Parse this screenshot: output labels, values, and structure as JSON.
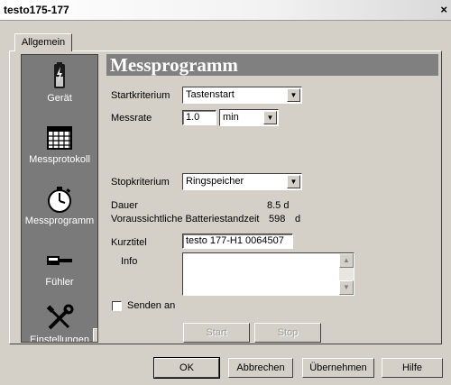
{
  "window": {
    "title": "testo175-177",
    "close_glyph": "×"
  },
  "tabs": [
    {
      "label": "Allgemein",
      "active": true
    }
  ],
  "sidebar": {
    "items": [
      {
        "label": "Gerät",
        "icon": "battery-device-icon"
      },
      {
        "label": "Messprotokoll",
        "icon": "table-grid-icon"
      },
      {
        "label": "Messprogramm",
        "icon": "stopwatch-icon",
        "active": true
      },
      {
        "label": "Fühler",
        "icon": "probe-icon"
      },
      {
        "label": "Einstellungen",
        "icon": "tools-icon"
      }
    ],
    "scroll_glyph": "▼"
  },
  "header": {
    "title": "Messprogramm"
  },
  "form": {
    "start_label": "Startkriterium",
    "start_value": "Tastenstart",
    "rate_label": "Messrate",
    "rate_value": "1.0",
    "rate_unit": "min",
    "stop_label": "Stopkriterium",
    "stop_value": "Ringspeicher",
    "duration_label": "Dauer",
    "duration_value": "8.5 d",
    "battery_label": "Voraussichtliche Batteriestandzeit",
    "battery_value": "598",
    "battery_unit": "d",
    "short_title_label": "Kurztitel",
    "short_title_value": "testo 177-H1 0064507",
    "info_label": "Info",
    "info_value": "",
    "send_label": "Senden an",
    "send_checked": false,
    "start_button": "Start",
    "stop_button": "Stop",
    "dropdown_glyph": "▼",
    "scroll_up_glyph": "▲",
    "scroll_down_glyph": "▼"
  },
  "footer": {
    "ok": "OK",
    "cancel": "Abbrechen",
    "apply": "Übernehmen",
    "help": "Hilfe"
  }
}
